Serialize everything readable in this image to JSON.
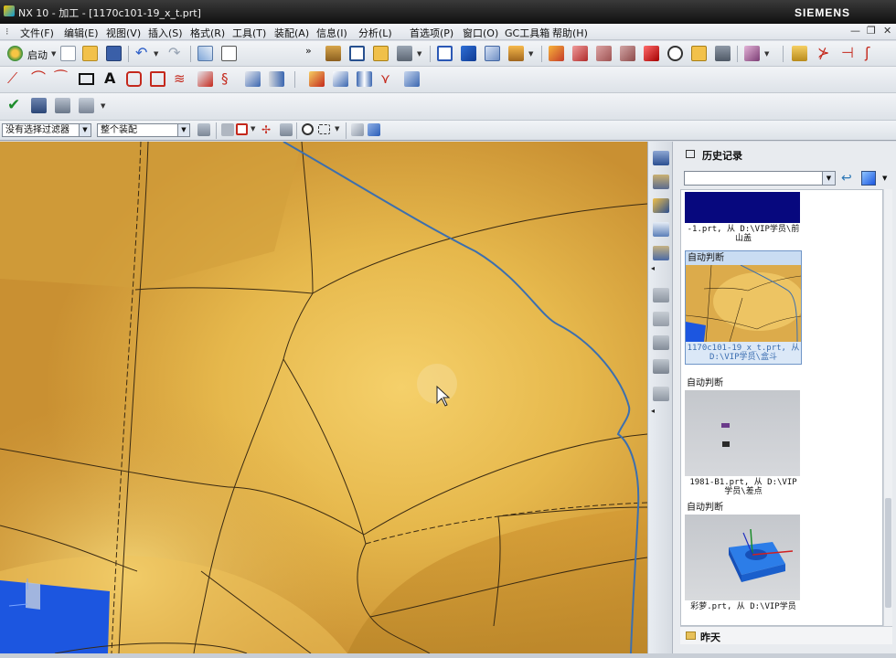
{
  "window": {
    "title": "NX 10 - 加工 - [1170c101-19_x_t.prt]",
    "brand": "SIEMENS"
  },
  "menu": [
    "文件(F)",
    "编辑(E)",
    "视图(V)",
    "插入(S)",
    "格式(R)",
    "工具(T)",
    "装配(A)",
    "信息(I)",
    "分析(L)",
    "首选项(P)",
    "窗口(O)",
    "GC工具箱",
    "帮助(H)"
  ],
  "toolbar": {
    "start_label": "启动"
  },
  "selection_bar": {
    "filter_value": "没有选择过滤器",
    "scope_value": "整个装配"
  },
  "icons": {
    "toolbar1": [
      "start-icon",
      "new-icon",
      "open-icon",
      "save-icon",
      "undo-icon",
      "redo-icon",
      "edit-icon",
      "copy-icon",
      "command-finder-icon",
      "window-icon",
      "open-folder-icon",
      "tool-icon",
      "fit-icon",
      "shaded-icon",
      "wireframe-icon",
      "view-orient-icon",
      "render-icon",
      "style-icon",
      "section-icon",
      "box-icon",
      "zoom-icon",
      "camera-icon",
      "layer-icon",
      "filter-icon",
      "measure-icon",
      "trim-icon",
      "extend-icon",
      "curve-icon"
    ],
    "toolbar2": [
      "line-icon",
      "arc-icon",
      "curve-icon",
      "rectangle-icon",
      "text-icon",
      "fillet-icon",
      "chamfer-icon",
      "offset-icon",
      "mirror-icon",
      "pattern-icon",
      "project-icon",
      "intersect-icon",
      "extract-icon",
      "bridge-icon",
      "wrap-icon",
      "tangent-icon",
      "edge-icon"
    ],
    "toolbar3": [
      "check-icon",
      "operation-icon",
      "program-icon",
      "post-icon"
    ],
    "side_strip": [
      "create-program-icon",
      "create-tool-icon",
      "create-geometry-icon",
      "create-method-icon",
      "create-operation-icon",
      "generate-path-icon",
      "verify-icon",
      "simulate-icon",
      "postprocess-icon",
      "shop-doc-icon"
    ],
    "panel": [
      "back-icon",
      "history-view-icon"
    ]
  },
  "history_panel": {
    "title": "历史记录",
    "combo_value": "",
    "items": [
      {
        "caption": "",
        "fname": "-1.prt, 从 D:\\VIP学员\\前山盖",
        "selected": false
      },
      {
        "caption": "自动判断",
        "fname": "1170c101-19_x_t.prt, 从 D:\\VIP学员\\盒斗",
        "selected": true
      },
      {
        "caption": "自动判断",
        "fname": "1981-B1.prt, 从 D:\\VIP学员\\差点",
        "selected": false
      },
      {
        "caption": "自动判断",
        "fname": "彩萝.prt, 从 D:\\VIP学员",
        "selected": false
      }
    ],
    "footer_label": "昨天"
  },
  "colors": {
    "part_surface": "#d9a63f",
    "viewport_blue": "#1c56e0",
    "selected_border": "#6f95c7"
  }
}
